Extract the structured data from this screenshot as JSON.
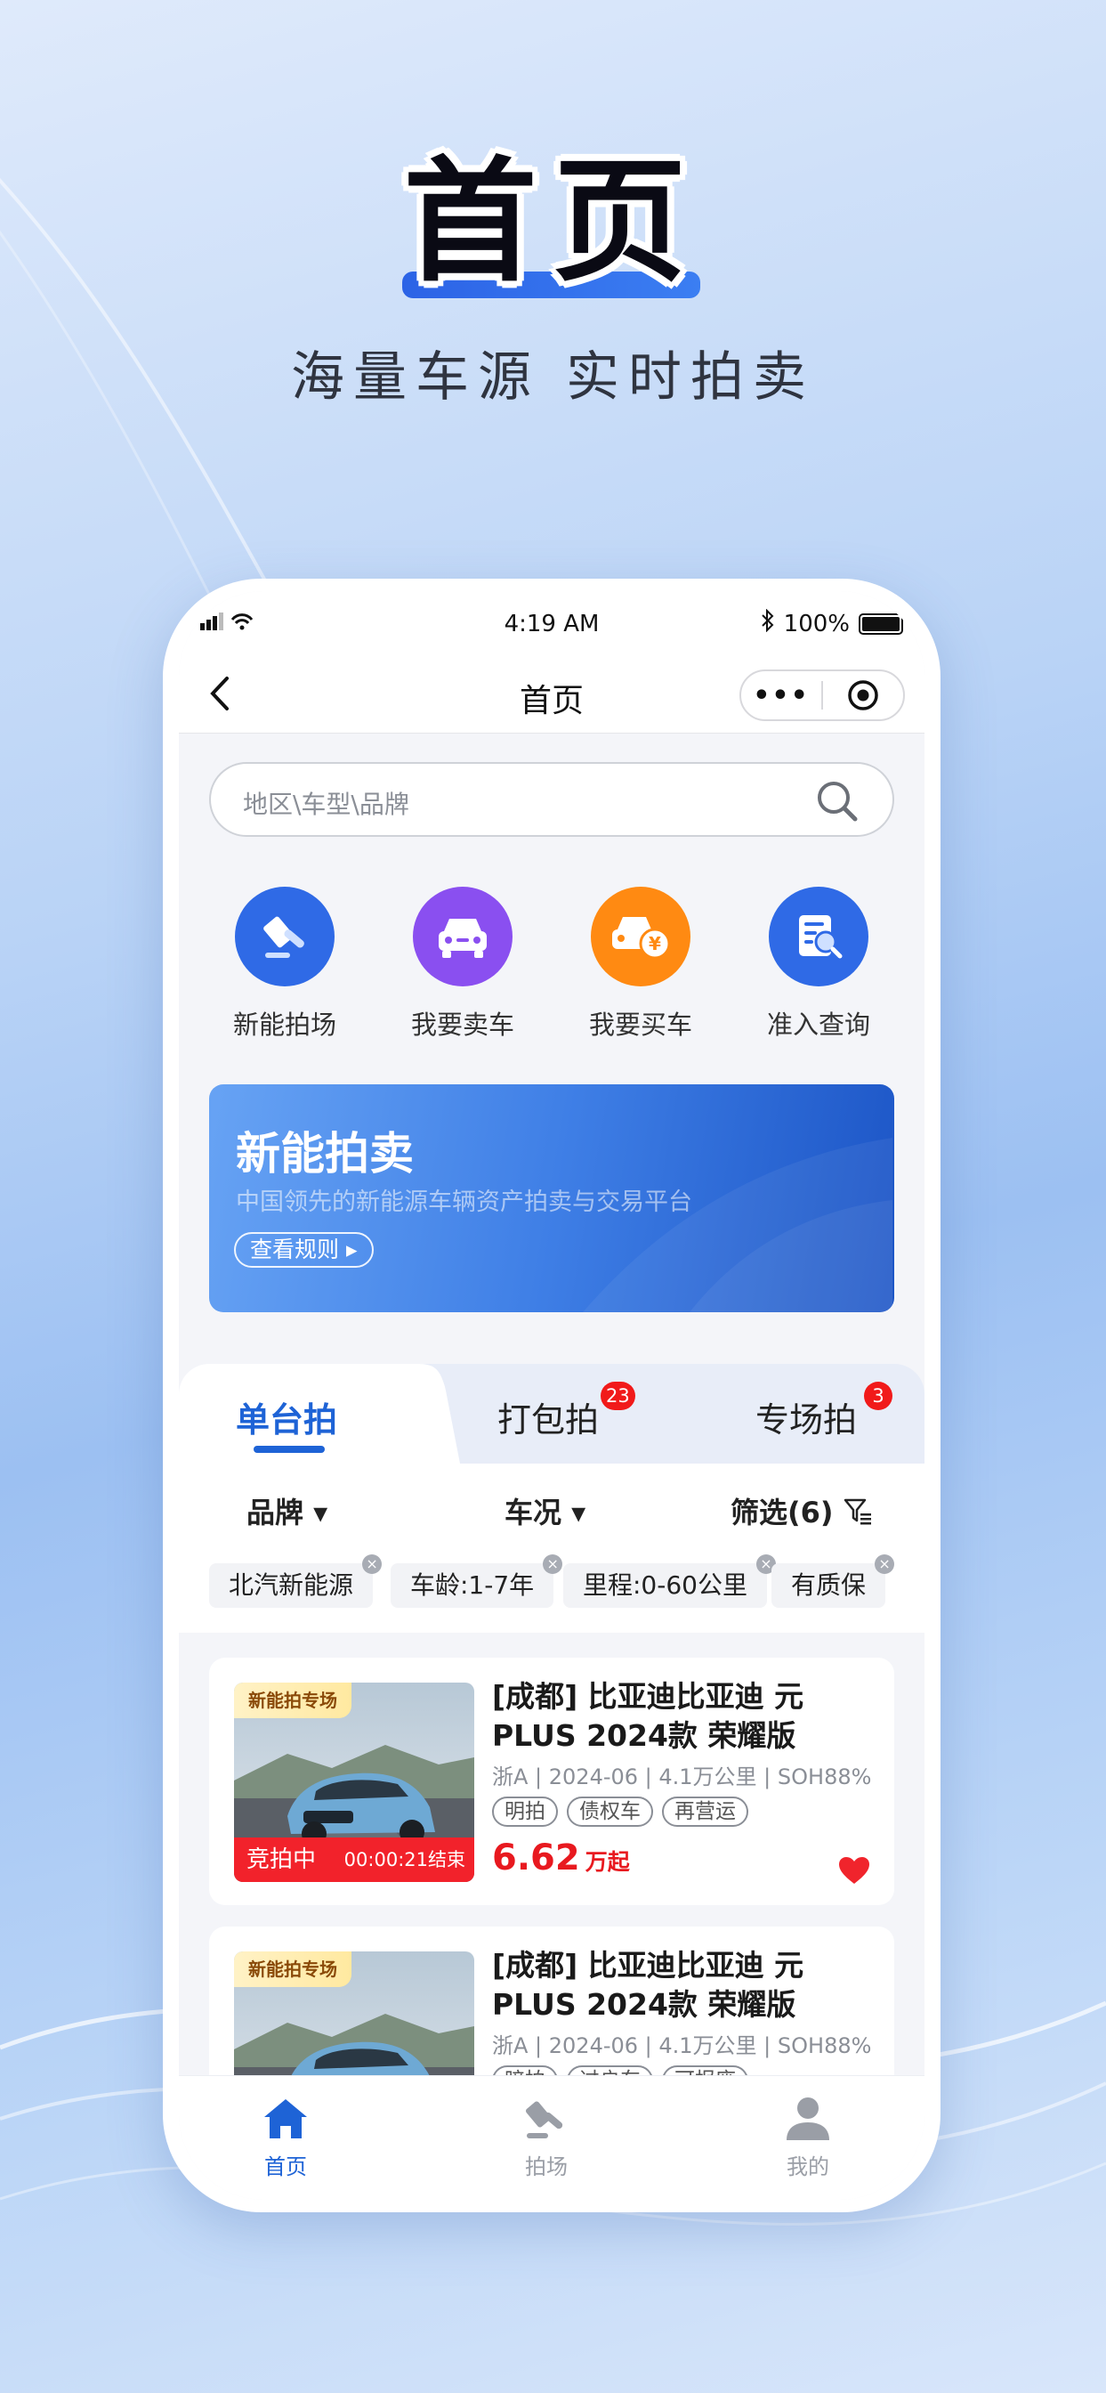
{
  "promo": {
    "title": "首页",
    "subtitle": "海量车源  实时拍卖"
  },
  "status_bar": {
    "time": "4:19 AM",
    "battery": "100%"
  },
  "nav": {
    "title": "首页",
    "more_label": "•••"
  },
  "search": {
    "placeholder": "地区\\车型\\品牌"
  },
  "quick_actions": [
    {
      "label": "新能拍场",
      "icon": "gavel-icon",
      "color": "#2f6ae6"
    },
    {
      "label": "我要卖车",
      "icon": "car-icon",
      "color": "#8a4ff0"
    },
    {
      "label": "我要买车",
      "icon": "car-yuan-icon",
      "color": "#ff8a12"
    },
    {
      "label": "准入查询",
      "icon": "document-search-icon",
      "color": "#2f6ae6"
    }
  ],
  "banner": {
    "title": "新能拍卖",
    "subtitle": "中国领先的新能源车辆资产拍卖与交易平台",
    "button_label": "查看规则 ▸"
  },
  "tabs": [
    {
      "label": "单台拍",
      "active": true,
      "badge": ""
    },
    {
      "label": "打包拍",
      "active": false,
      "badge": "23"
    },
    {
      "label": "专场拍",
      "active": false,
      "badge": "3"
    }
  ],
  "filters": [
    {
      "label": "品牌 ▾"
    },
    {
      "label": "车况 ▾"
    },
    {
      "label": "筛选(6)"
    }
  ],
  "active_tags": [
    "北汽新能源",
    "车龄:1-7年",
    "里程:0-60公里",
    "有质保"
  ],
  "listings": [
    {
      "tag": "新能拍专场",
      "title": "[成都] 比亚迪比亚迪 元PLUS 2024款 荣耀版",
      "meta": "浙A | 2024-06 | 4.1万公里 | SOH88%",
      "chips": [
        "明拍",
        "债权车",
        "再营运"
      ],
      "status": "竞拍中",
      "timer": "00:00:21结束",
      "price": "6.62",
      "price_unit": "万起",
      "favorited": true
    },
    {
      "tag": "新能拍专场",
      "title": "[成都] 比亚迪比亚迪 元PLUS 2024款 荣耀版",
      "meta": "浙A | 2024-06 | 4.1万公里 | SOH88%",
      "chips": [
        "暗拍",
        "过户车",
        "可报废"
      ],
      "status": "",
      "timer": "",
      "price": "",
      "price_unit": "",
      "favorited": false
    }
  ],
  "tab_bar": [
    {
      "label": "首页",
      "icon": "home-icon",
      "active": true
    },
    {
      "label": "拍场",
      "icon": "gavel-icon",
      "active": false
    },
    {
      "label": "我的",
      "icon": "user-icon",
      "active": false
    }
  ],
  "colors": {
    "accent": "#1e63d6",
    "price": "#e8191f",
    "badge": "#f11a1a"
  }
}
